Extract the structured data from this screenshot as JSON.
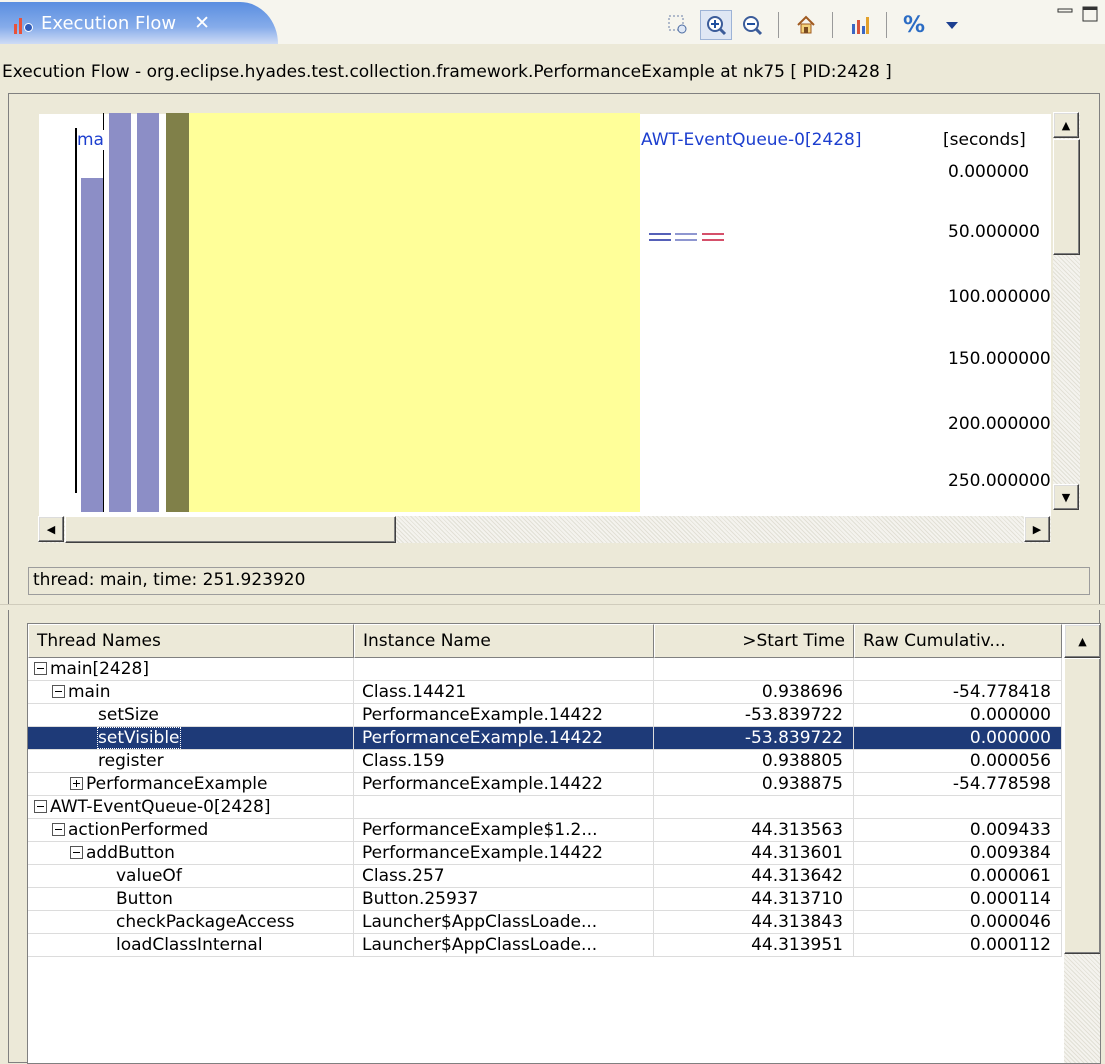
{
  "tab": {
    "title": "Execution Flow",
    "close": "✕"
  },
  "toolbar": {
    "percent_label": "%"
  },
  "header": {
    "text": "Execution Flow - org.eclipse.hyades.test.collection.framework.PerformanceExample at nk75 [ PID:2428 ]"
  },
  "graph": {
    "thread_label_main": "ma",
    "thread_label_awt": "AWT-EventQueue-0[2428]",
    "unit_label": "[seconds]",
    "ticks": [
      "0.000000",
      "50.000000",
      "100.000000",
      "150.000000",
      "200.000000",
      "250.000000"
    ],
    "colors": {
      "bar_blue": "#8c8ec6",
      "bar_olive": "#808049",
      "region_yellow": "#ffff99",
      "label_blue": "#1c3ecf"
    }
  },
  "status": {
    "text": "thread: main, time: 251.923920"
  },
  "table": {
    "columns": [
      "Thread Names",
      "Instance Name",
      ">Start Time",
      "Raw Cumulativ..."
    ],
    "rows": [
      {
        "name": "main[2428]",
        "expander": "minus",
        "instance": "",
        "start": "",
        "raw": ""
      },
      {
        "name": "main",
        "expander": "minus",
        "instance": "Class.14421",
        "start": "0.938696",
        "raw": "-54.778418"
      },
      {
        "name": "setSize",
        "expander": "",
        "instance": "PerformanceExample.14422",
        "start": "-53.839722",
        "raw": "0.000000"
      },
      {
        "name": "setVisible",
        "expander": "",
        "instance": "PerformanceExample.14422",
        "start": "-53.839722",
        "raw": "0.000000",
        "selected": true
      },
      {
        "name": "register",
        "expander": "",
        "instance": "Class.159",
        "start": "0.938805",
        "raw": "0.000056"
      },
      {
        "name": "PerformanceExample",
        "expander": "plus",
        "instance": "PerformanceExample.14422",
        "start": "0.938875",
        "raw": "-54.778598"
      },
      {
        "name": "AWT-EventQueue-0[2428]",
        "expander": "minus",
        "instance": "",
        "start": "",
        "raw": ""
      },
      {
        "name": "actionPerformed",
        "expander": "minus",
        "instance": "PerformanceExample$1.2...",
        "start": "44.313563",
        "raw": "0.009433"
      },
      {
        "name": "addButton",
        "expander": "minus",
        "instance": "PerformanceExample.14422",
        "start": "44.313601",
        "raw": "0.009384"
      },
      {
        "name": "valueOf",
        "expander": "",
        "instance": "Class.257",
        "start": "44.313642",
        "raw": "0.000061"
      },
      {
        "name": "Button",
        "expander": "",
        "instance": "Button.25937",
        "start": "44.313710",
        "raw": "0.000114"
      },
      {
        "name": "checkPackageAccess",
        "expander": "",
        "instance": "Launcher$AppClassLoade...",
        "start": "44.313843",
        "raw": "0.000046"
      },
      {
        "name": "loadClassInternal",
        "expander": "",
        "instance": "Launcher$AppClassLoade...",
        "start": "44.313951",
        "raw": "0.000112"
      }
    ]
  }
}
